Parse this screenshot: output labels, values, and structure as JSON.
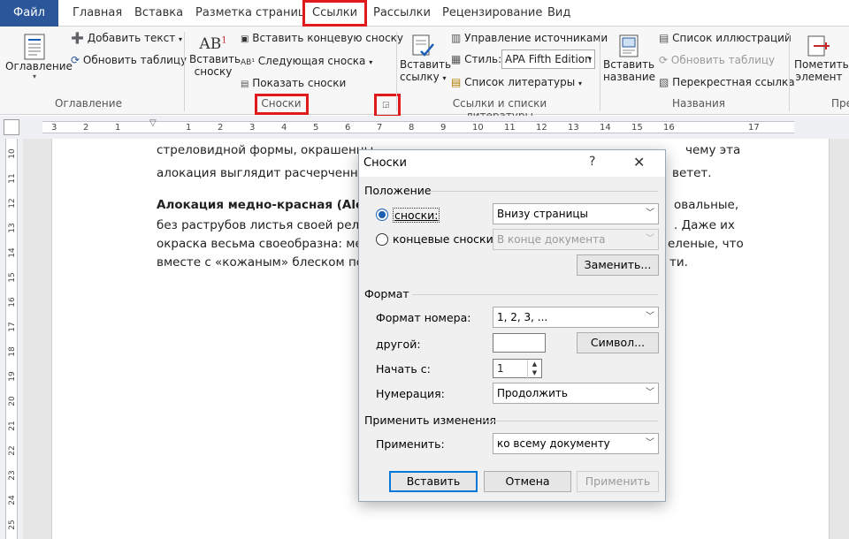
{
  "tabs": [
    "Файл",
    "Главная",
    "Вставка",
    "Разметка страницы",
    "Ссылки",
    "Рассылки",
    "Рецензирование",
    "Вид"
  ],
  "ribbon": {
    "toc": {
      "button": "Оглавление",
      "add_text": "Добавить текст",
      "update_table": "Обновить таблицу",
      "group": "Оглавление"
    },
    "footnotes": {
      "insert_footnote_line1": "Вставить",
      "insert_footnote_line2": "сноску",
      "insert_endnote": "Вставить концевую сноску",
      "next_footnote": "Следующая сноска",
      "show_notes": "Показать сноски",
      "group": "Сноски",
      "icon_text": "AB"
    },
    "citations": {
      "insert_citation_line1": "Вставить",
      "insert_citation_line2": "ссылку",
      "manage_sources": "Управление источниками",
      "style_label": "Стиль:",
      "style_value": "APA Fifth Edition",
      "bibliography": "Список литературы",
      "group": "Ссылки и списки литературы"
    },
    "captions": {
      "insert_caption_line1": "Вставить",
      "insert_caption_line2": "название",
      "table_of_figures": "Список иллюстраций",
      "update_table": "Обновить таблицу",
      "cross_reference": "Перекрестная ссылка",
      "group": "Названия"
    },
    "index": {
      "mark_entry_line1": "Пометить",
      "mark_entry_line2": "элемент",
      "group": "Пре"
    }
  },
  "ruler": {
    "h": [
      "3",
      "2",
      "1",
      "1",
      "2",
      "3",
      "4",
      "5",
      "6",
      "7",
      "8",
      "9",
      "10",
      "11",
      "12",
      "13",
      "14",
      "15",
      "16",
      "17"
    ],
    "v": [
      "10",
      "11",
      "12",
      "13",
      "14",
      "15",
      "16",
      "17",
      "18",
      "19",
      "20",
      "21",
      "22",
      "23",
      "24",
      "25"
    ]
  },
  "doc": {
    "line1_left": "стреловидной формы, окрашенны",
    "line1_right": "чему эта",
    "line2_left": "алокация выглядит расчерченной",
    "line2_right": "ветет.",
    "p2_bold": "Алокация медно-красная (Alocasi",
    "p2_right1": "овальные,",
    "p2_line2_left": "без раструбов листья своей рельеф",
    "p2_line2_right": ". Даже их",
    "p2_line3_left": "окраска весьма своеобразна: меж",
    "p2_line3_right": "еленые, что",
    "p2_line4_left": "вместе с «кожаным» блеском пов",
    "p2_line4_right": "ти."
  },
  "dialog": {
    "title": "Сноски",
    "help": "?",
    "close": "✕",
    "position_header": "Положение",
    "footnotes_label": "сноски:",
    "footnotes_value": "Внизу страницы",
    "endnotes_label": "концевые сноски:",
    "endnotes_value": "В конце документа",
    "replace_button": "Заменить...",
    "format_header": "Формат",
    "number_format_label": "Формат номера:",
    "number_format_value": "1, 2, 3, ...",
    "custom_label": "другой:",
    "custom_value": "",
    "symbol_button": "Символ...",
    "start_at_label": "Начать с:",
    "start_at_value": "1",
    "numbering_label": "Нумерация:",
    "numbering_value": "Продолжить",
    "apply_header": "Применить изменения",
    "apply_label": "Применить:",
    "apply_value": "ко всему документу",
    "insert_button": "Вставить",
    "cancel_button": "Отмена",
    "apply_button": "Применить"
  },
  "colors": {
    "file_tab": "#2b579a",
    "highlight": "#e0191a",
    "radio": "#1a5fb4"
  }
}
